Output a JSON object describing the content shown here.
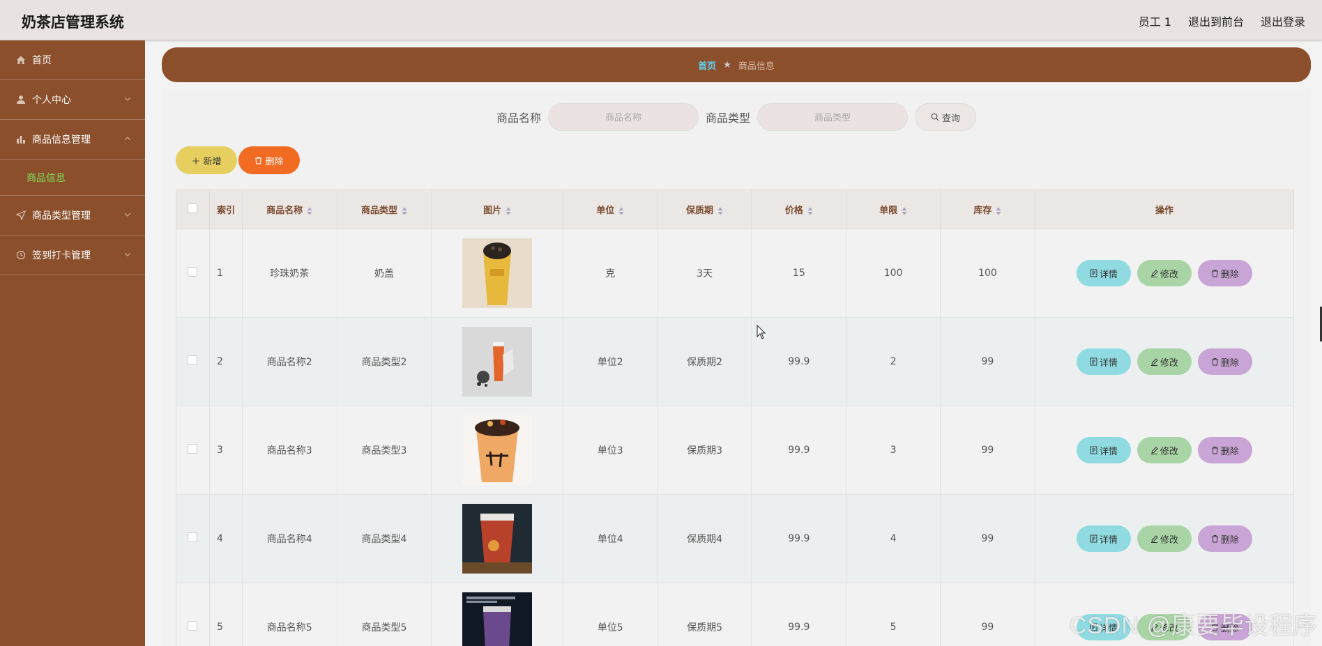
{
  "app": {
    "title": "奶茶店管理系统"
  },
  "header": {
    "user": "员工 1",
    "front": "退出到前台",
    "logout": "退出登录"
  },
  "sidebar": {
    "items": [
      {
        "label": "首页",
        "icon": "home-icon"
      },
      {
        "label": "个人中心",
        "icon": "user-icon"
      },
      {
        "label": "商品信息管理",
        "icon": "bar-chart-icon"
      },
      {
        "label": "商品类型管理",
        "icon": "send-icon"
      },
      {
        "label": "签到打卡管理",
        "icon": "clock-icon"
      }
    ],
    "sub_item": "商品信息"
  },
  "breadcrumb": {
    "home": "首页",
    "current": "商品信息"
  },
  "search": {
    "name_label": "商品名称",
    "name_placeholder": "商品名称",
    "type_label": "商品类型",
    "type_placeholder": "商品类型",
    "query": "查询"
  },
  "actions": {
    "add": "新增",
    "delete": "删除"
  },
  "table": {
    "columns": [
      "索引",
      "商品名称",
      "商品类型",
      "图片",
      "单位",
      "保质期",
      "价格",
      "单限",
      "库存",
      "操作"
    ],
    "rows": [
      {
        "idx": "1",
        "name": "珍珠奶茶",
        "type": "奶盖",
        "unit": "克",
        "shelf": "3天",
        "price": "15",
        "limit": "100",
        "stock": "100"
      },
      {
        "idx": "2",
        "name": "商品名称2",
        "type": "商品类型2",
        "unit": "单位2",
        "shelf": "保质期2",
        "price": "99.9",
        "limit": "2",
        "stock": "99"
      },
      {
        "idx": "3",
        "name": "商品名称3",
        "type": "商品类型3",
        "unit": "单位3",
        "shelf": "保质期3",
        "price": "99.9",
        "limit": "3",
        "stock": "99"
      },
      {
        "idx": "4",
        "name": "商品名称4",
        "type": "商品类型4",
        "unit": "单位4",
        "shelf": "保质期4",
        "price": "99.9",
        "limit": "4",
        "stock": "99"
      },
      {
        "idx": "5",
        "name": "商品名称5",
        "type": "商品类型5",
        "unit": "单位5",
        "shelf": "保质期5",
        "price": "99.9",
        "limit": "5",
        "stock": "99"
      }
    ],
    "row_actions": {
      "detail": "详情",
      "edit": "修改",
      "delete": "删除"
    }
  },
  "watermark": "CSDN @康要毕设程序"
}
